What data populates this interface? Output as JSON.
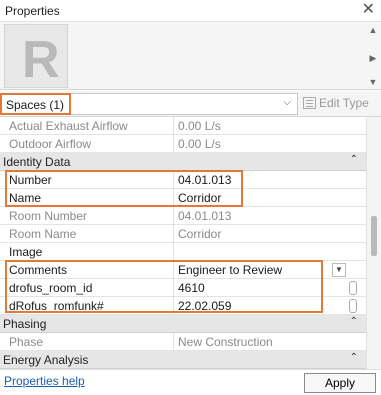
{
  "window": {
    "title": "Properties",
    "close_glyph": "✕"
  },
  "preview": {
    "logo_letter": "R"
  },
  "type_selector": {
    "value": "Spaces (1)",
    "edit_type_label": "Edit Type"
  },
  "rows": [
    {
      "label": "Actual Exhaust Airflow",
      "value": "0.00 L/s",
      "kind": "greyed"
    },
    {
      "label": "Outdoor Airflow",
      "value": "0.00 L/s",
      "kind": "greyed"
    },
    {
      "label": "Identity Data",
      "kind": "group"
    },
    {
      "label": "Number",
      "value": "04.01.013",
      "kind": "editable"
    },
    {
      "label": "Name",
      "value": "Corridor",
      "kind": "editable"
    },
    {
      "label": "Room Number",
      "value": "04.01.013",
      "kind": "greyed"
    },
    {
      "label": "Room Name",
      "value": "Corridor",
      "kind": "greyed"
    },
    {
      "label": "Image",
      "value": "",
      "kind": "editable"
    },
    {
      "label": "Comments",
      "value": "Engineer to Review",
      "kind": "editable"
    },
    {
      "label": "drofus_room_id",
      "value": "4610",
      "kind": "editable"
    },
    {
      "label": "dRofus_romfunk#",
      "value": "22.02.059",
      "kind": "editable"
    },
    {
      "label": "Phasing",
      "kind": "group"
    },
    {
      "label": "Phase",
      "value": "New Construction",
      "kind": "greyed"
    },
    {
      "label": "Energy Analysis",
      "kind": "group"
    }
  ],
  "footer": {
    "help_link": "Properties help",
    "apply_button": "Apply"
  },
  "colors": {
    "highlight": "#e07a3a",
    "link": "#1a5fb4",
    "group_bg": "#e6e6e6"
  }
}
